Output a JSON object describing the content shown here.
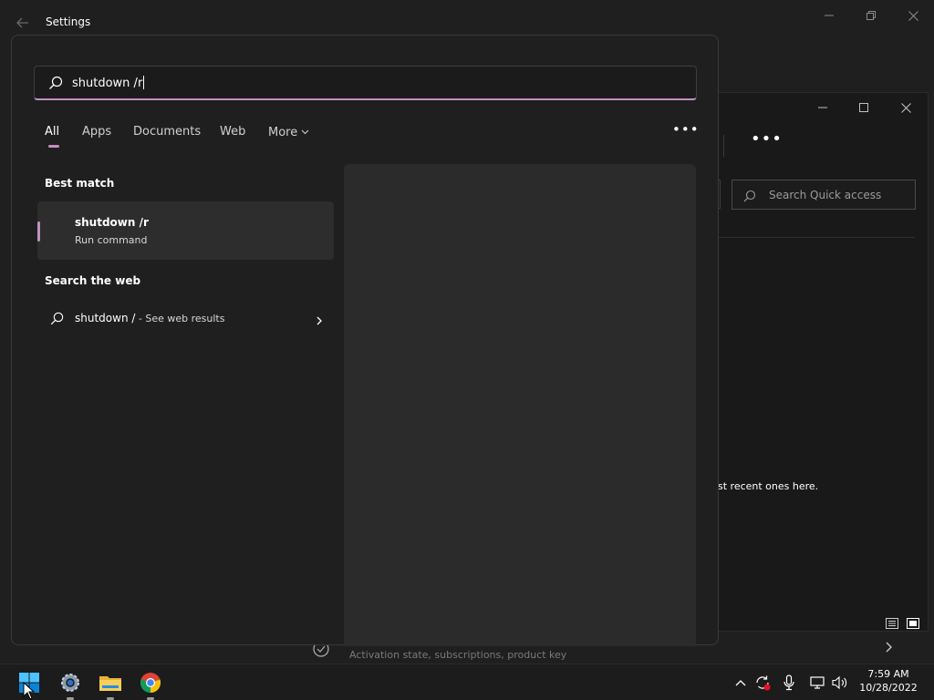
{
  "settings_window": {
    "title": "Settings",
    "back_icon": "arrow-left-icon",
    "bottom_row_text": "Activation state, subscriptions, product key"
  },
  "explorer_window": {
    "search_placeholder": "Search Quick access",
    "recent_text": "st recent ones here."
  },
  "search": {
    "query": "shutdown /r",
    "tabs": [
      {
        "label": "All",
        "active": true
      },
      {
        "label": "Apps"
      },
      {
        "label": "Documents"
      },
      {
        "label": "Web"
      },
      {
        "label": "More"
      }
    ],
    "best_match_heading": "Best match",
    "best_match": {
      "title": "shutdown /r",
      "subtitle": "Run command"
    },
    "web_heading": "Search the web",
    "web_result": {
      "query": "shutdown /",
      "suffix": " - See web results"
    }
  },
  "taskbar": {
    "apps": [
      "start-icon",
      "settings-icon",
      "file-explorer-icon",
      "chrome-icon"
    ],
    "time": "7:59 AM",
    "date": "10/28/2022"
  },
  "colors": {
    "accent": "#c28fc2",
    "panel_bg": "#1f1f1f",
    "selected_bg": "#2d2d2d",
    "preview_bg": "#2b2b2b"
  }
}
